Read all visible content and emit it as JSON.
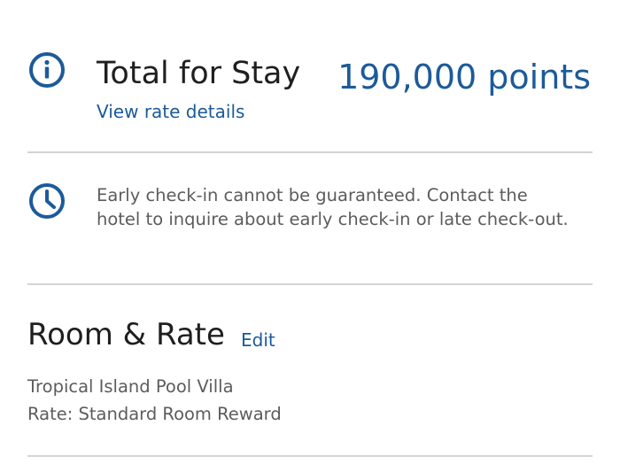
{
  "total": {
    "title": "Total for Stay",
    "view_rate_link": "View rate details",
    "amount": "190,000 points",
    "icon": "info-icon"
  },
  "notice": {
    "icon": "clock-icon",
    "text": "Early check-in cannot be guaranteed. Contact the hotel to inquire about early check-in or late check-out."
  },
  "room_rate": {
    "heading": "Room & Rate",
    "edit_link": "Edit",
    "room_name": "Tropical Island Pool Villa",
    "rate_line": "Rate: Standard Room Reward"
  },
  "colors": {
    "accent": "#1c5a9a",
    "text": "#1f1f1f",
    "muted": "#5c5c5c",
    "divider": "#d4d4d4"
  }
}
